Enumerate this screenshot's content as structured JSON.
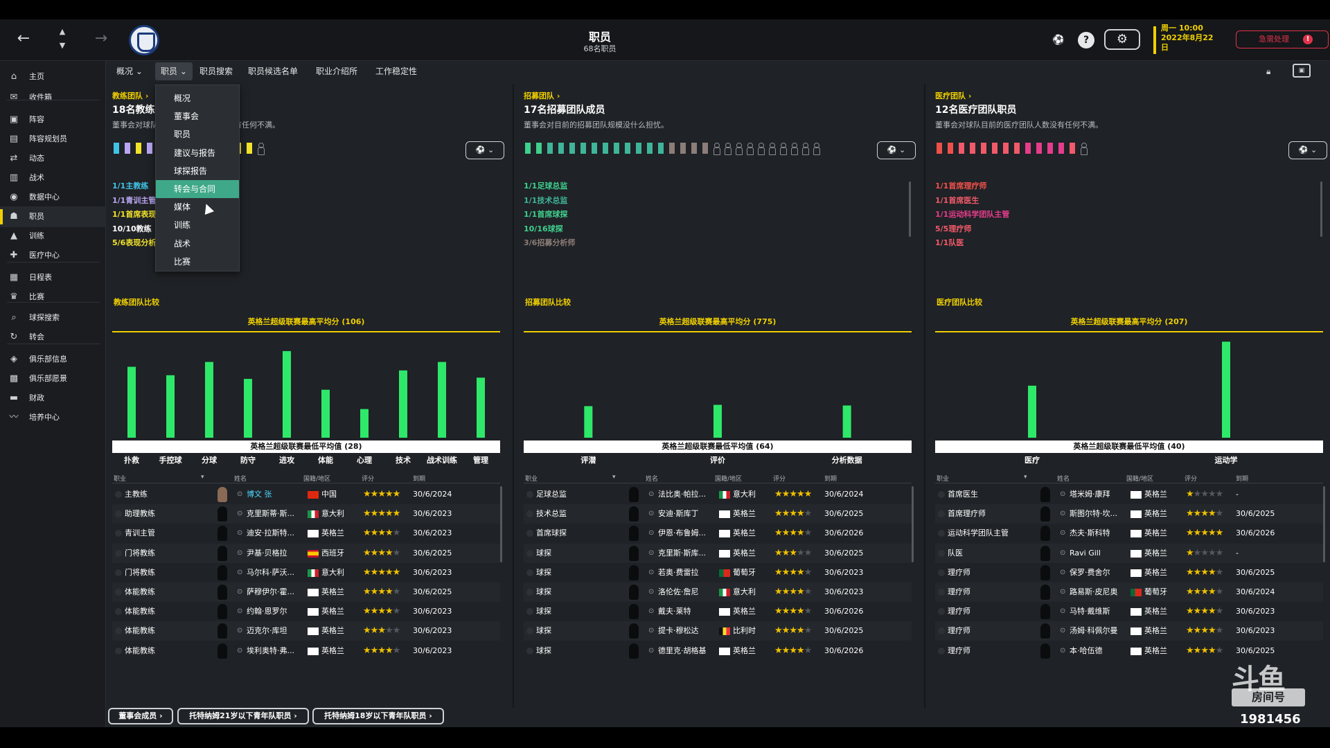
{
  "header": {
    "title": "职员",
    "subtitle": "68名职员",
    "date_line1": "周一 10:00",
    "date_line2": "2022年8月22",
    "date_line3": "日",
    "urgent": "急需处理"
  },
  "sidebar": [
    {
      "label": "主页",
      "icon": "home-icon",
      "glyph": "⌂"
    },
    {
      "label": "收件箱",
      "icon": "inbox-icon",
      "glyph": "✉"
    },
    {
      "label": "阵容",
      "icon": "squad-icon",
      "glyph": "▣"
    },
    {
      "label": "阵容规划员",
      "icon": "planner-icon",
      "glyph": "▤"
    },
    {
      "label": "动态",
      "icon": "dynamics-icon",
      "glyph": "⇄"
    },
    {
      "label": "战术",
      "icon": "tactics-icon",
      "glyph": "▥"
    },
    {
      "label": "数据中心",
      "icon": "data-hub-icon",
      "glyph": "◉"
    },
    {
      "label": "职员",
      "icon": "staff-icon",
      "glyph": "☗"
    },
    {
      "label": "训练",
      "icon": "training-icon",
      "glyph": "▲"
    },
    {
      "label": "医疗中心",
      "icon": "medical-icon",
      "glyph": "✚"
    },
    {
      "label": "日程表",
      "icon": "calendar-icon",
      "glyph": "▦"
    },
    {
      "label": "比赛",
      "icon": "trophy-icon",
      "glyph": "♛"
    },
    {
      "label": "球探搜索",
      "icon": "scout-search-icon",
      "glyph": "⌕"
    },
    {
      "label": "转会",
      "icon": "transfer-icon",
      "glyph": "↻"
    },
    {
      "label": "俱乐部信息",
      "icon": "club-info-icon",
      "glyph": "◈"
    },
    {
      "label": "俱乐部愿景",
      "icon": "club-vision-icon",
      "glyph": "▩"
    },
    {
      "label": "财政",
      "icon": "finance-icon",
      "glyph": "▬"
    },
    {
      "label": "培养中心",
      "icon": "development-icon",
      "glyph": "〰"
    }
  ],
  "tabs": [
    "概况",
    "职员",
    "职员搜索",
    "职员候选名单",
    "职业介绍所",
    "工作稳定性"
  ],
  "dropdown": [
    "概况",
    "董事会",
    "职员",
    "建议与报告",
    "球探报告",
    "转会与合同",
    "媒体",
    "训练",
    "战术",
    "比赛"
  ],
  "filter_label": "⚽ ⌄",
  "panels": [
    {
      "link": "教练团队 ›",
      "title": "18名教练团队成员",
      "desc": "董事会对球队目前的教练团队规模没有任何不满。",
      "people_colors": [
        "#41c3e6",
        "#b9a6f2",
        "#f2e32b",
        "#b9a6f2",
        "#41c3e6",
        "#41c3e6",
        "#f2e32b",
        "#41c3e6",
        "#f2e32b",
        "#f2e32b",
        "#f2e32b",
        "#f2e32b",
        "#f2e32b",
        "empty"
      ],
      "roles": [
        {
          "text": "1/1主教练",
          "color": "#41c3e6"
        },
        {
          "text": "1/1青训主管",
          "color": "#b9a6f2"
        },
        {
          "text": "1/1首席表现分析师",
          "color": "#f2e32b"
        },
        {
          "text": "10/10教练（",
          "color": "#ffffff"
        },
        {
          "text": "5/6表现分析师",
          "color": "#f2e32b"
        }
      ],
      "compare_label": "教练团队比较",
      "avg_top": "英格兰超级联赛最高平均分 (106)",
      "avg_bottom": "英格兰超级联赛最低平均值 (28)",
      "columns": [
        "职业",
        "姓名",
        "国籍/地区",
        "评分",
        "到期"
      ],
      "rows": [
        {
          "role": "主教练",
          "name": "博文 张",
          "nat": "中国",
          "flag": "cn",
          "stars": 5,
          "exp": "30/6/2024",
          "highlight": true
        },
        {
          "role": "助理教练",
          "name": "克里斯蒂·斯...",
          "nat": "意大利",
          "flag": "it",
          "stars": 5,
          "exp": "30/6/2023"
        },
        {
          "role": "青训主管",
          "name": "迪安·拉斯特...",
          "nat": "英格兰",
          "flag": "en",
          "stars": 4,
          "exp": "30/6/2023"
        },
        {
          "role": "门将教练",
          "name": "尹基·贝格拉",
          "nat": "西班牙",
          "flag": "es",
          "stars": 4,
          "exp": "30/6/2025"
        },
        {
          "role": "门将教练",
          "name": "马尔科·萨沃...",
          "nat": "意大利",
          "flag": "it",
          "stars": 4.5,
          "exp": "30/6/2023"
        },
        {
          "role": "体能教练",
          "name": "萨穆伊尔·霍...",
          "nat": "英格兰",
          "flag": "en",
          "stars": 4,
          "exp": "30/6/2025"
        },
        {
          "role": "体能教练",
          "name": "约翰·恩罗尔",
          "nat": "英格兰",
          "flag": "en",
          "stars": 3.5,
          "exp": "30/6/2023"
        },
        {
          "role": "体能教练",
          "name": "迈克尔·库坦",
          "nat": "英格兰",
          "flag": "en",
          "stars": 3,
          "exp": "30/6/2023"
        },
        {
          "role": "体能教练",
          "name": "埃利奥特·弗...",
          "nat": "英格兰",
          "flag": "en",
          "stars": 3.5,
          "exp": "30/6/2023"
        }
      ]
    },
    {
      "link": "招募团队 ›",
      "title": "17名招募团队成员",
      "desc": "董事会对目前的招募团队规模没什么担忧。",
      "people_colors": [
        "#3fcf8e",
        "#3fcf8e",
        "#3fb59a",
        "#3fb59a",
        "#3fb59a",
        "#3fb59a",
        "#3fb59a",
        "#3fb59a",
        "#3fb59a",
        "#3fb59a",
        "#3fb59a",
        "#3fb59a",
        "#3fb59a",
        "#8c7d78",
        "#8c7d78",
        "#8c7d78",
        "#8c7d78",
        "empty",
        "empty",
        "empty",
        "empty",
        "empty",
        "empty",
        "empty",
        "empty",
        "empty",
        "empty"
      ],
      "roles": [
        {
          "text": "1/1足球总监",
          "color": "#3fcf8e"
        },
        {
          "text": "1/1技术总监",
          "color": "#3fb59a"
        },
        {
          "text": "1/1首席球探",
          "color": "#3fcf8e"
        },
        {
          "text": "10/16球探",
          "color": "#3fcf8e"
        },
        {
          "text": "3/6招募分析师",
          "color": "#8c7d78"
        }
      ],
      "compare_label": "招募团队比较",
      "avg_top": "英格兰超级联赛最高平均分 (775)",
      "avg_bottom": "英格兰超级联赛最低平均值 (64)",
      "columns": [
        "职业",
        "姓名",
        "国籍/地区",
        "评分",
        "到期"
      ],
      "rows": [
        {
          "role": "足球总监",
          "name": "法比奥·帕拉...",
          "nat": "意大利",
          "flag": "it",
          "stars": 4.5,
          "exp": "30/6/2024"
        },
        {
          "role": "技术总监",
          "name": "安迪·斯库丁",
          "nat": "英格兰",
          "flag": "en",
          "stars": 3.5,
          "exp": "30/6/2025"
        },
        {
          "role": "首席球探",
          "name": "伊恩·布鲁姆...",
          "nat": "英格兰",
          "flag": "en",
          "stars": 4,
          "exp": "30/6/2026"
        },
        {
          "role": "球探",
          "name": "克里斯·斯库...",
          "nat": "英格兰",
          "flag": "en",
          "stars": 3,
          "exp": "30/6/2025"
        },
        {
          "role": "球探",
          "name": "若奥·费雷拉",
          "nat": "葡萄牙",
          "flag": "pt",
          "stars": 3.5,
          "exp": "30/6/2023"
        },
        {
          "role": "球探",
          "name": "洛伦佐·詹尼",
          "nat": "意大利",
          "flag": "it",
          "stars": 4,
          "exp": "30/6/2023"
        },
        {
          "role": "球探",
          "name": "戴夫·莱特",
          "nat": "英格兰",
          "flag": "en",
          "stars": 3.5,
          "exp": "30/6/2026"
        },
        {
          "role": "球探",
          "name": "提卡·穆松达",
          "nat": "比利时",
          "flag": "be",
          "stars": 3.5,
          "exp": "30/6/2025"
        },
        {
          "role": "球探",
          "name": "德里克·胡格基",
          "nat": "英格兰",
          "flag": "en",
          "stars": 4,
          "exp": "30/6/2026"
        }
      ]
    },
    {
      "link": "医疗团队 ›",
      "title": "12名医疗团队职员",
      "desc": "董事会对球队目前的医疗团队人数没有任何不满。",
      "people_colors": [
        "#f0504a",
        "#f0504a",
        "#f05a6a",
        "#f05a6a",
        "#f05a6a",
        "#f05a6a",
        "#f05a6a",
        "#f05a6a",
        "#e63c8c",
        "#e63c8c",
        "#e63c8c",
        "#e63c8c",
        "#f05a6a",
        "empty"
      ],
      "roles": [
        {
          "text": "1/1首席理疗师",
          "color": "#f0504a"
        },
        {
          "text": "1/1首席医生",
          "color": "#f05a6a"
        },
        {
          "text": "1/1运动科学团队主管",
          "color": "#e63c8c"
        },
        {
          "text": "5/5理疗师",
          "color": "#f05a6a"
        },
        {
          "text": "1/1队医",
          "color": "#f05a6a"
        }
      ],
      "compare_label": "医疗团队比较",
      "avg_top": "英格兰超级联赛最高平均分 (207)",
      "avg_bottom": "英格兰超级联赛最低平均值 (40)",
      "columns": [
        "职业",
        "姓名",
        "国籍/地区",
        "评分",
        "到期"
      ],
      "rows": [
        {
          "role": "首席医生",
          "name": "塔米姆·康拜",
          "nat": "英格兰",
          "flag": "en",
          "stars": 0.5,
          "exp": "-"
        },
        {
          "role": "首席理疗师",
          "name": "斯图尔特·坎...",
          "nat": "英格兰",
          "flag": "en",
          "stars": 4,
          "exp": "30/6/2025"
        },
        {
          "role": "运动科学团队主管",
          "name": "杰夫·斯科特",
          "nat": "英格兰",
          "flag": "en",
          "stars": 4.5,
          "exp": "30/6/2026"
        },
        {
          "role": "队医",
          "name": "Ravi Gill",
          "nat": "英格兰",
          "flag": "en",
          "stars": 0.5,
          "exp": "-"
        },
        {
          "role": "理疗师",
          "name": "保罗·费舍尔",
          "nat": "英格兰",
          "flag": "en",
          "stars": 3.5,
          "exp": "30/6/2025"
        },
        {
          "role": "理疗师",
          "name": "路易斯·皮尼奥",
          "nat": "葡萄牙",
          "flag": "pt",
          "stars": 3.5,
          "exp": "30/6/2024"
        },
        {
          "role": "理疗师",
          "name": "马特·戴维斯",
          "nat": "英格兰",
          "flag": "en",
          "stars": 4,
          "exp": "30/6/2023"
        },
        {
          "role": "理疗师",
          "name": "汤姆·科佩尔曼",
          "nat": "英格兰",
          "flag": "en",
          "stars": 4,
          "exp": "30/6/2023"
        },
        {
          "role": "理疗师",
          "name": "本·哈伍德",
          "nat": "英格兰",
          "flag": "en",
          "stars": 3.5,
          "exp": "30/6/2025"
        }
      ]
    }
  ],
  "chart_data": [
    {
      "type": "bar",
      "title": "教练团队比较",
      "categories": [
        "扑救",
        "手控球",
        "分球",
        "防守",
        "进攻",
        "体能",
        "心理",
        "技术",
        "战术训练",
        "管理"
      ],
      "values": [
        81,
        74,
        85,
        71,
        94,
        62,
        46,
        78,
        85,
        72
      ],
      "ylim": [
        28,
        106
      ],
      "color": "#2ee86a"
    },
    {
      "type": "bar",
      "title": "招募团队比较",
      "categories": [
        "评潜",
        "评价",
        "分析数据"
      ],
      "values": [
        250,
        260,
        255
      ],
      "ylim": [
        64,
        775
      ],
      "color": "#2ee86a"
    },
    {
      "type": "bar",
      "title": "医疗团队比较",
      "categories": [
        "医疗",
        "运动学"
      ],
      "values": [
        120,
        198
      ],
      "ylim": [
        40,
        207
      ],
      "color": "#2ee86a"
    }
  ],
  "bottom_buttons": [
    "董事会成员 ›",
    "托特纳姆21岁以下青年队职员 ›",
    "托特纳姆18岁以下青年队职员 ›"
  ],
  "watermark": {
    "logo": "斗鱼",
    "room_label": "房间号",
    "room_number": "1981456"
  }
}
